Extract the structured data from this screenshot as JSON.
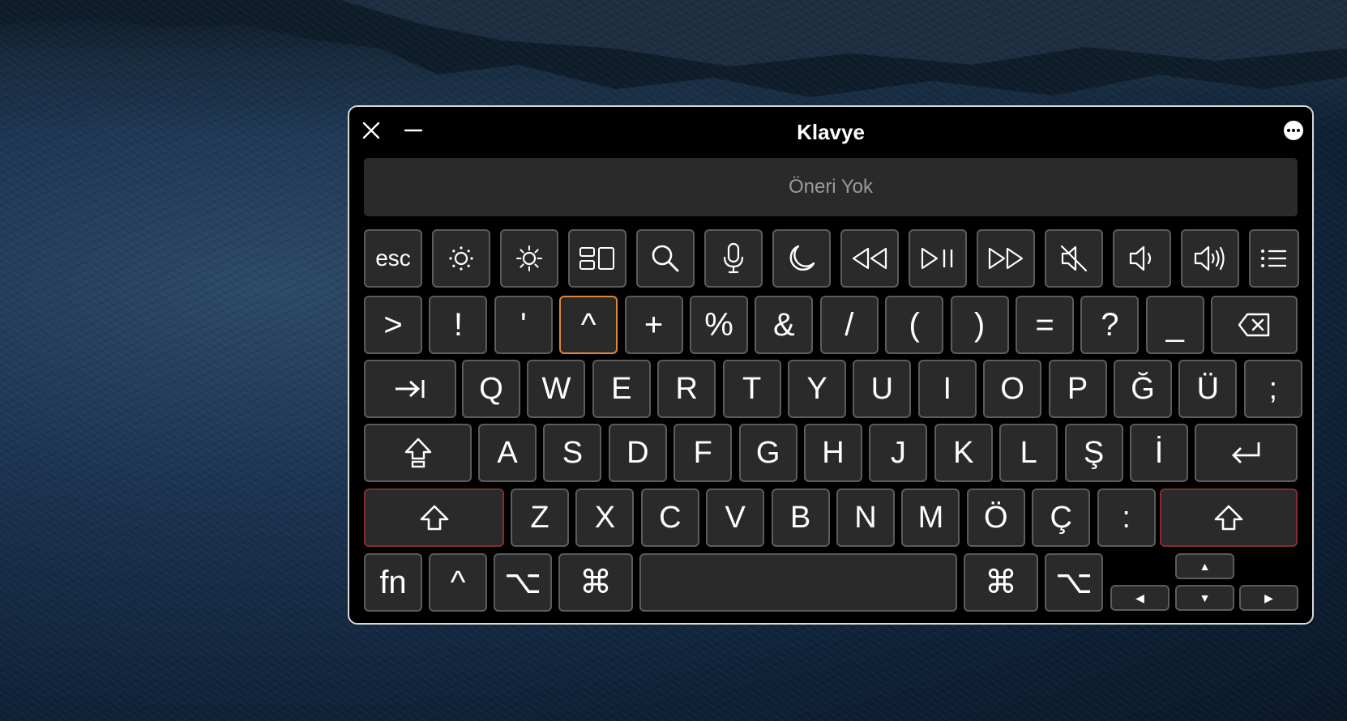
{
  "window": {
    "title": "Klavye"
  },
  "suggestion": "Öneri Yok",
  "rows": {
    "fn_row": [
      {
        "name": "esc-key",
        "label": "esc",
        "icon": null
      },
      {
        "name": "brightness-down-key",
        "label": "",
        "icon": "brightness-down-icon"
      },
      {
        "name": "brightness-up-key",
        "label": "",
        "icon": "brightness-up-icon"
      },
      {
        "name": "mission-control-key",
        "label": "",
        "icon": "mission-control-icon"
      },
      {
        "name": "spotlight-key",
        "label": "",
        "icon": "search-icon"
      },
      {
        "name": "dictation-key",
        "label": "",
        "icon": "microphone-icon"
      },
      {
        "name": "do-not-disturb-key",
        "label": "",
        "icon": "moon-icon"
      },
      {
        "name": "rewind-key",
        "label": "",
        "icon": "rewind-icon"
      },
      {
        "name": "play-pause-key",
        "label": "",
        "icon": "play-pause-icon"
      },
      {
        "name": "fast-forward-key",
        "label": "",
        "icon": "fast-forward-icon"
      },
      {
        "name": "mute-key",
        "label": "",
        "icon": "mute-icon"
      },
      {
        "name": "volume-down-key",
        "label": "",
        "icon": "volume-down-icon"
      },
      {
        "name": "volume-up-key",
        "label": "",
        "icon": "volume-up-icon"
      },
      {
        "name": "list-key",
        "label": "",
        "icon": "list-icon"
      }
    ],
    "number_row": [
      ">",
      "!",
      "'",
      "^",
      "+",
      "%",
      "&",
      "/",
      "(",
      ")",
      "=",
      "?",
      "_"
    ],
    "q_row": [
      "Q",
      "W",
      "E",
      "R",
      "T",
      "Y",
      "U",
      "I",
      "O",
      "P",
      "Ğ",
      "Ü",
      ";"
    ],
    "a_row": [
      "A",
      "S",
      "D",
      "F",
      "G",
      "H",
      "J",
      "K",
      "L",
      "Ş",
      "İ"
    ],
    "z_row": [
      "Z",
      "X",
      "C",
      "V",
      "B",
      "N",
      "M",
      "Ö",
      "Ç",
      ":"
    ],
    "bottom": {
      "fn": "fn",
      "ctrl": "^",
      "option": "⌥",
      "command": "⌘",
      "arrow_up": "▲",
      "arrow_down": "▼",
      "arrow_left": "◀",
      "arrow_right": "▶"
    }
  },
  "highlighted_key": "^",
  "colors": {
    "active_border": "#d8893a",
    "shift_border": "#8a2b2b"
  }
}
